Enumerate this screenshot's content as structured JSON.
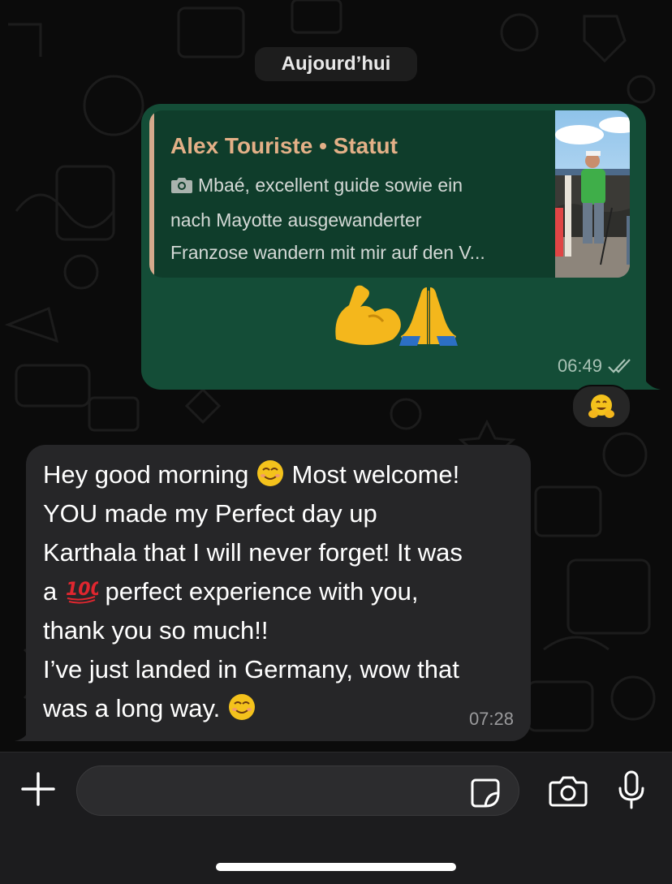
{
  "date_separator": "Aujourd’hui",
  "outgoing_message": {
    "quoted_status": {
      "author_line": "Alex Touriste • Statut",
      "media_type_icon": "camera-icon",
      "caption_lines": [
        "Mbaé, excellent guide sowie ein",
        "nach Mayotte ausgewanderter",
        "Franzose wandern mit mir auf den V..."
      ],
      "thumbnail": "hiker-photo-thumbnail"
    },
    "emojis": [
      "flexed-biceps-emoji",
      "folded-hands-emoji"
    ],
    "time": "06:49",
    "status_icon": "double-check-icon",
    "reaction": "hugging-face-emoji"
  },
  "incoming_message": {
    "lines": [
      {
        "before": "Hey good morning ",
        "emoji": "smiling-face-emoji",
        "after": " Most welcome!"
      },
      {
        "before": "YOU made my Perfect day up",
        "emoji": null,
        "after": ""
      },
      {
        "before": "Karthala that I will never forget! It was",
        "emoji": null,
        "after": ""
      },
      {
        "before": "a ",
        "emoji": "hundred-points-emoji",
        "after": " perfect experience with you,"
      },
      {
        "before": "thank you so much!!",
        "emoji": null,
        "after": ""
      },
      {
        "before": "I’ve just landed in Germany, wow that",
        "emoji": null,
        "after": ""
      },
      {
        "before": "was a long way. ",
        "emoji": "smiling-face-emoji",
        "after": ""
      }
    ],
    "time": "07:28"
  },
  "composer": {
    "plus_icon": "plus-icon",
    "input_value": "",
    "sticker_icon": "sticker-icon",
    "camera_icon": "camera-icon",
    "mic_icon": "microphone-icon"
  },
  "colors": {
    "background": "#0b0b0b",
    "outgoing_bubble": "#144d37",
    "quote_box": "#0f3d2b",
    "quote_author": "#e3b087",
    "incoming_bubble": "#262628",
    "composer_bar": "#1c1c1e"
  }
}
